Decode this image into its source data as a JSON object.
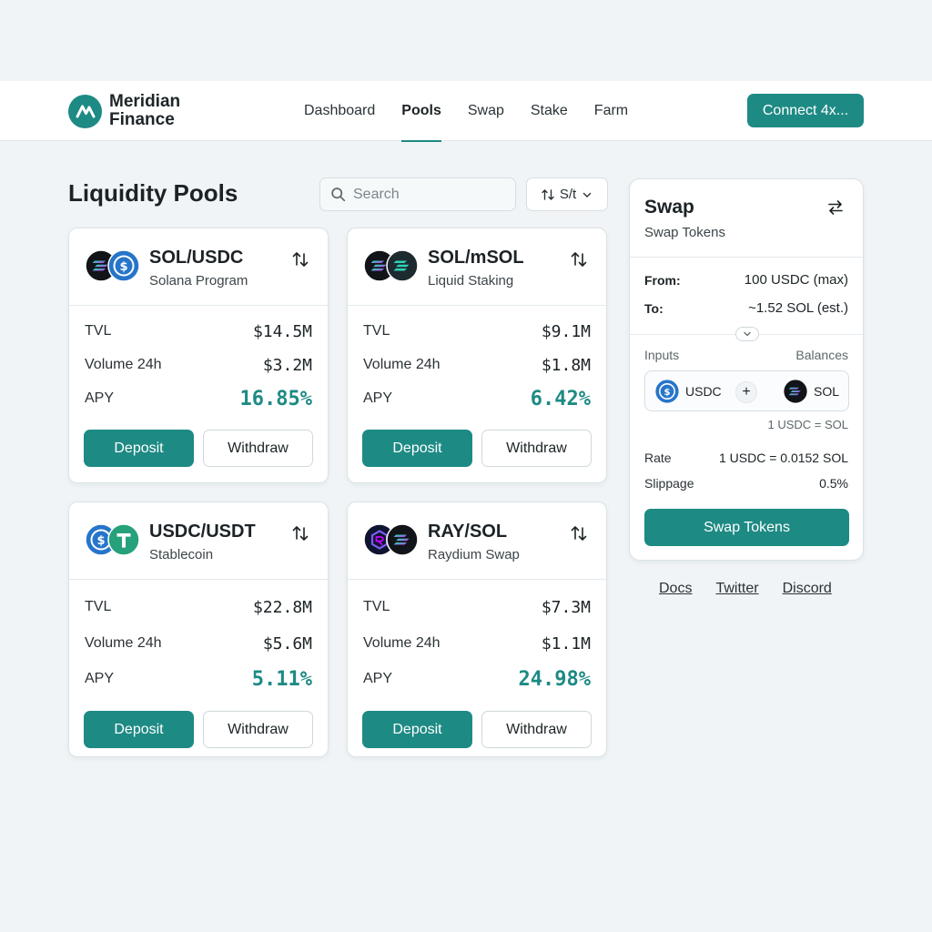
{
  "brand": {
    "line1": "Meridian",
    "line2": "Finance"
  },
  "nav": {
    "links": [
      "Dashboard",
      "Pools",
      "Swap",
      "Stake",
      "Farm"
    ],
    "active": "Pools",
    "connect_label": "Connect 4x..."
  },
  "main": {
    "title": "Liquidity Pools",
    "search_placeholder": "Search",
    "sort_label": "S/t"
  },
  "pools": [
    {
      "pair": "SOL/USDC",
      "subtitle": "Solana Program",
      "icons": [
        "sol-icon",
        "usdc-icon"
      ],
      "tvl_label": "TVL",
      "tvl": "$14.5M",
      "volume_label": "Volume 24h",
      "volume": "$3.2M",
      "apy_label": "APY",
      "apy": "16.85%",
      "deposit_label": "Deposit",
      "withdraw_label": "Withdraw"
    },
    {
      "pair": "SOL/mSOL",
      "subtitle": "Liquid Staking",
      "icons": [
        "sol-icon",
        "msol-icon"
      ],
      "tvl_label": "TVL",
      "tvl": "$9.1M",
      "volume_label": "Volume 24h",
      "volume": "$1.8M",
      "apy_label": "APY",
      "apy": "6.42%",
      "deposit_label": "Deposit",
      "withdraw_label": "Withdraw"
    },
    {
      "pair": "USDC/USDT",
      "subtitle": "Stablecoin",
      "icons": [
        "usdc-icon",
        "usdt-icon"
      ],
      "tvl_label": "TVL",
      "tvl": "$22.8M",
      "volume_label": "Volume 24h",
      "volume": "$5.6M",
      "apy_label": "APY",
      "apy": "5.11%",
      "deposit_label": "Deposit",
      "withdraw_label": "Withdraw"
    },
    {
      "pair": "RAY/SOL",
      "subtitle": "Raydium Swap",
      "icons": [
        "ray-icon",
        "sol-icon"
      ],
      "tvl_label": "TVL",
      "tvl": "$7.3M",
      "volume_label": "Volume 24h",
      "volume": "$1.1M",
      "apy_label": "APY",
      "apy": "24.98%",
      "deposit_label": "Deposit",
      "withdraw_label": "Withdraw"
    }
  ],
  "swap": {
    "title": "Swap",
    "subtitle": "Swap Tokens",
    "from_label": "From:",
    "from_value": "100 USDC (max)",
    "to_label": "To:",
    "to_value": "~1.52 SOL (est.)",
    "inputs_label": "Inputs",
    "balances_label": "Balances",
    "token_a": "USDC",
    "token_b": "SOL",
    "plus": "+",
    "pair_rate": "1 USDC = SOL",
    "rate_label": "Rate",
    "rate_value": "1 USDC = 0.0152 SOL",
    "slippage_label": "Slippage",
    "slippage_value": "0.5%",
    "button_label": "Swap Tokens"
  },
  "footer": {
    "links": [
      "Docs",
      "Twitter",
      "Discord"
    ]
  },
  "colors": {
    "accent": "#1e8a84",
    "background": "#f0f4f6",
    "card": "#ffffff"
  }
}
